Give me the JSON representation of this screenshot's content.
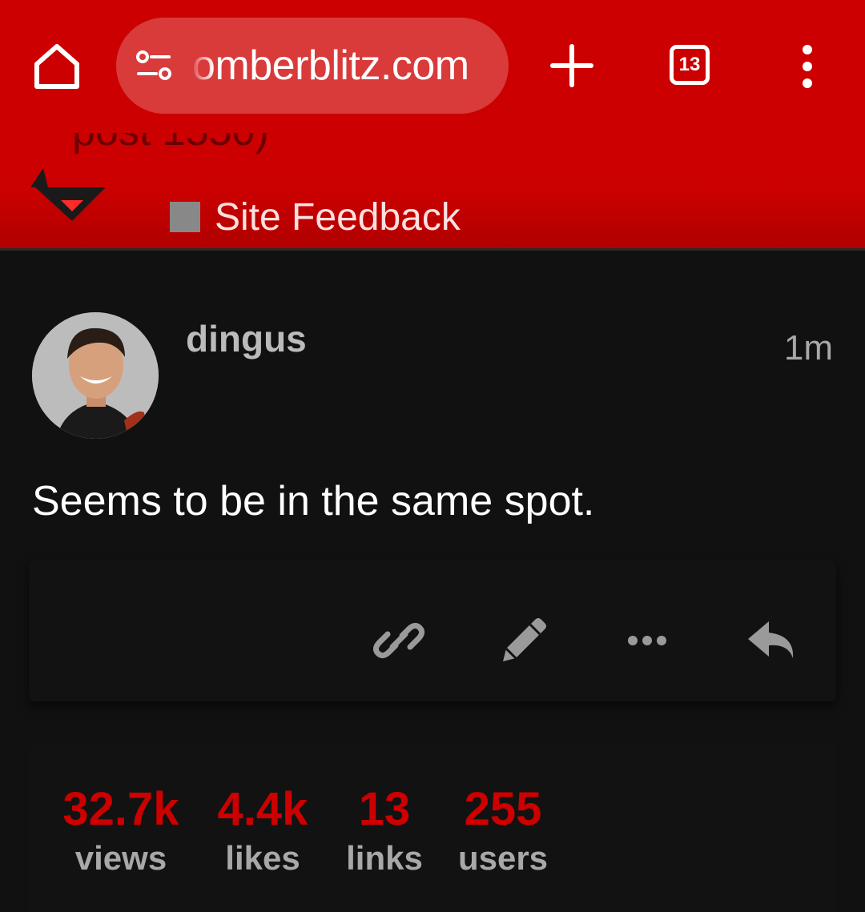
{
  "browser": {
    "url": "omberblitz.com",
    "tab_count": "13"
  },
  "header": {
    "topic_title_partial": "post 1550)",
    "category": "Site Feedback",
    "category_color": "#888888",
    "brand_color": "#cc0000"
  },
  "post": {
    "username": "dingus",
    "date": "1m",
    "body": "Seems to be in the same spot.",
    "actions": [
      "link-icon",
      "pencil-icon",
      "more-icon",
      "reply-icon"
    ]
  },
  "stats": [
    {
      "value": "32.7k",
      "label": "views"
    },
    {
      "value": "4.4k",
      "label": "likes"
    },
    {
      "value": "13",
      "label": "links"
    },
    {
      "value": "255",
      "label": "users"
    }
  ]
}
